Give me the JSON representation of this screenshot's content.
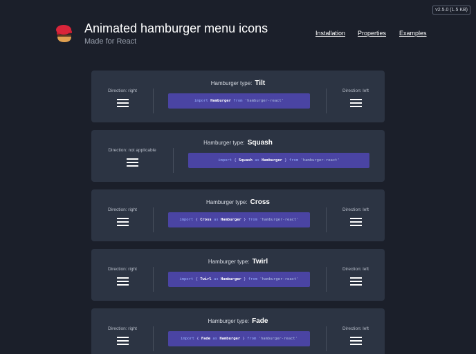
{
  "version": "v2.5.0 (1.5 KB)",
  "header": {
    "title": "Animated hamburger menu icons",
    "subtitle": "Made for React"
  },
  "nav": [
    "Installation",
    "Properties",
    "Examples"
  ],
  "type_label": "Hamburger type:",
  "cards": [
    {
      "type": "Tilt",
      "left": "Direction: right",
      "right": "Direction: left",
      "code": [
        [
          "k",
          "import "
        ],
        [
          "n",
          "Hamburger"
        ],
        [
          "k",
          " from "
        ],
        [
          "s",
          "'hamburger-react'"
        ]
      ]
    },
    {
      "type": "Squash",
      "left": "Direction: not applicable",
      "right": null,
      "code": [
        [
          "k",
          "import "
        ],
        [
          "p",
          "{ "
        ],
        [
          "n",
          "Squash"
        ],
        [
          "k",
          " as "
        ],
        [
          "n",
          "Hamburger"
        ],
        [
          "p",
          " }"
        ],
        [
          "k",
          " from "
        ],
        [
          "s",
          "'hamburger-react'"
        ]
      ]
    },
    {
      "type": "Cross",
      "left": "Direction: right",
      "right": "Direction: left",
      "code": [
        [
          "k",
          "import "
        ],
        [
          "p",
          "{ "
        ],
        [
          "n",
          "Cross"
        ],
        [
          "k",
          " as "
        ],
        [
          "n",
          "Hamburger"
        ],
        [
          "p",
          " }"
        ],
        [
          "k",
          " from "
        ],
        [
          "s",
          "'hamburger-react'"
        ]
      ]
    },
    {
      "type": "Twirl",
      "left": "Direction: right",
      "right": "Direction: left",
      "code": [
        [
          "k",
          "import "
        ],
        [
          "p",
          "{ "
        ],
        [
          "n",
          "Twirl"
        ],
        [
          "k",
          " as "
        ],
        [
          "n",
          "Hamburger"
        ],
        [
          "p",
          " }"
        ],
        [
          "k",
          " from "
        ],
        [
          "s",
          "'hamburger-react'"
        ]
      ]
    },
    {
      "type": "Fade",
      "left": "Direction: right",
      "right": "Direction: left",
      "code": [
        [
          "k",
          "import "
        ],
        [
          "p",
          "{ "
        ],
        [
          "n",
          "Fade"
        ],
        [
          "k",
          " as "
        ],
        [
          "n",
          "Hamburger"
        ],
        [
          "p",
          " }"
        ],
        [
          "k",
          " from "
        ],
        [
          "s",
          "'hamburger-react'"
        ]
      ]
    }
  ]
}
